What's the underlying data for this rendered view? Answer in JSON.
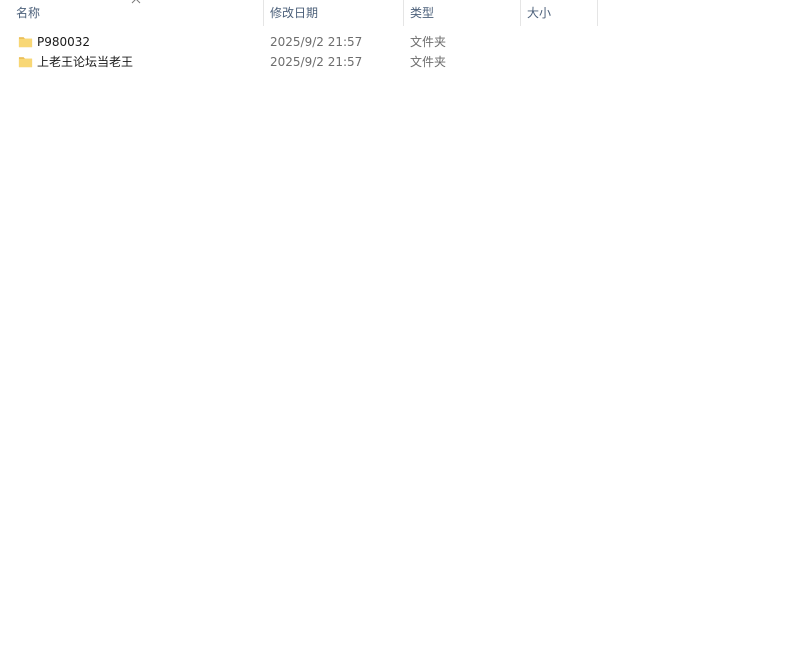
{
  "columns": {
    "name": "名称",
    "date": "修改日期",
    "type": "类型",
    "size": "大小"
  },
  "sort": {
    "column": "name",
    "direction": "ascending",
    "icon": "chevron-up-icon"
  },
  "rows": [
    {
      "name": "P980032",
      "date": "2025/9/2 21:57",
      "type": "文件夹",
      "size": "",
      "icon": "folder-icon"
    },
    {
      "name": "上老王论坛当老王",
      "date": "2025/9/2 21:57",
      "type": "文件夹",
      "size": "",
      "icon": "folder-icon"
    }
  ],
  "colors": {
    "header_text": "#4c607a",
    "folder_fill": "#f8d775",
    "folder_tab": "#e8b74a"
  }
}
